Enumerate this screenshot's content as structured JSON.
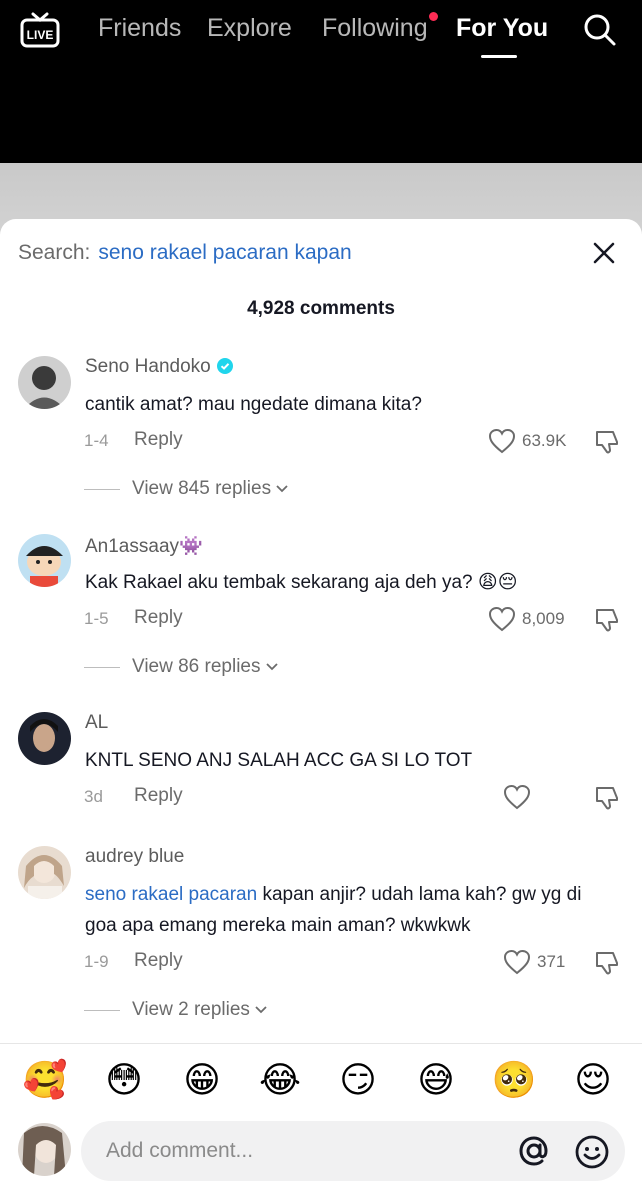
{
  "nav": {
    "live_label": "LIVE",
    "tabs": [
      "Friends",
      "Explore",
      "Following",
      "For You"
    ],
    "active_tab": "For You"
  },
  "sheet": {
    "search_label": "Search:",
    "search_query": "seno rakael pacaran kapan",
    "comment_count": "4,928 comments"
  },
  "comments": [
    {
      "username": "Seno Handoko",
      "verified": true,
      "text": "cantik amat? mau ngedate dimana kita?",
      "date": "1-4",
      "reply_label": "Reply",
      "likes": "63.9K",
      "view_replies": "View 845 replies"
    },
    {
      "username": "An1assaay👾",
      "text": "Kak Rakael aku tembak sekarang aja deh ya? 😩😔",
      "date": "1-5",
      "reply_label": "Reply",
      "likes": "8,009",
      "view_replies": "View 86 replies"
    },
    {
      "username": "AL",
      "text": "KNTL SENO ANJ SALAH ACC GA SI LO TOT",
      "date": "3d",
      "reply_label": "Reply",
      "likes": ""
    },
    {
      "username": "audrey blue",
      "mention": "seno rakael pacaran",
      "text": " kapan anjir? udah lama kah? gw yg di goa apa emang mereka main aman? wkwkwk",
      "date": "1-9",
      "reply_label": "Reply",
      "likes": "371",
      "view_replies": "View 2 replies"
    }
  ],
  "emoji_bar": [
    "🥰",
    "😳",
    "😁",
    "😂",
    "😏",
    "😅",
    "🥺",
    "😌"
  ],
  "input": {
    "placeholder": "Add comment..."
  },
  "colors": {
    "mention": "#2b6cc4",
    "notification_dot": "#fe2c55",
    "verified": "#20d5ec"
  }
}
